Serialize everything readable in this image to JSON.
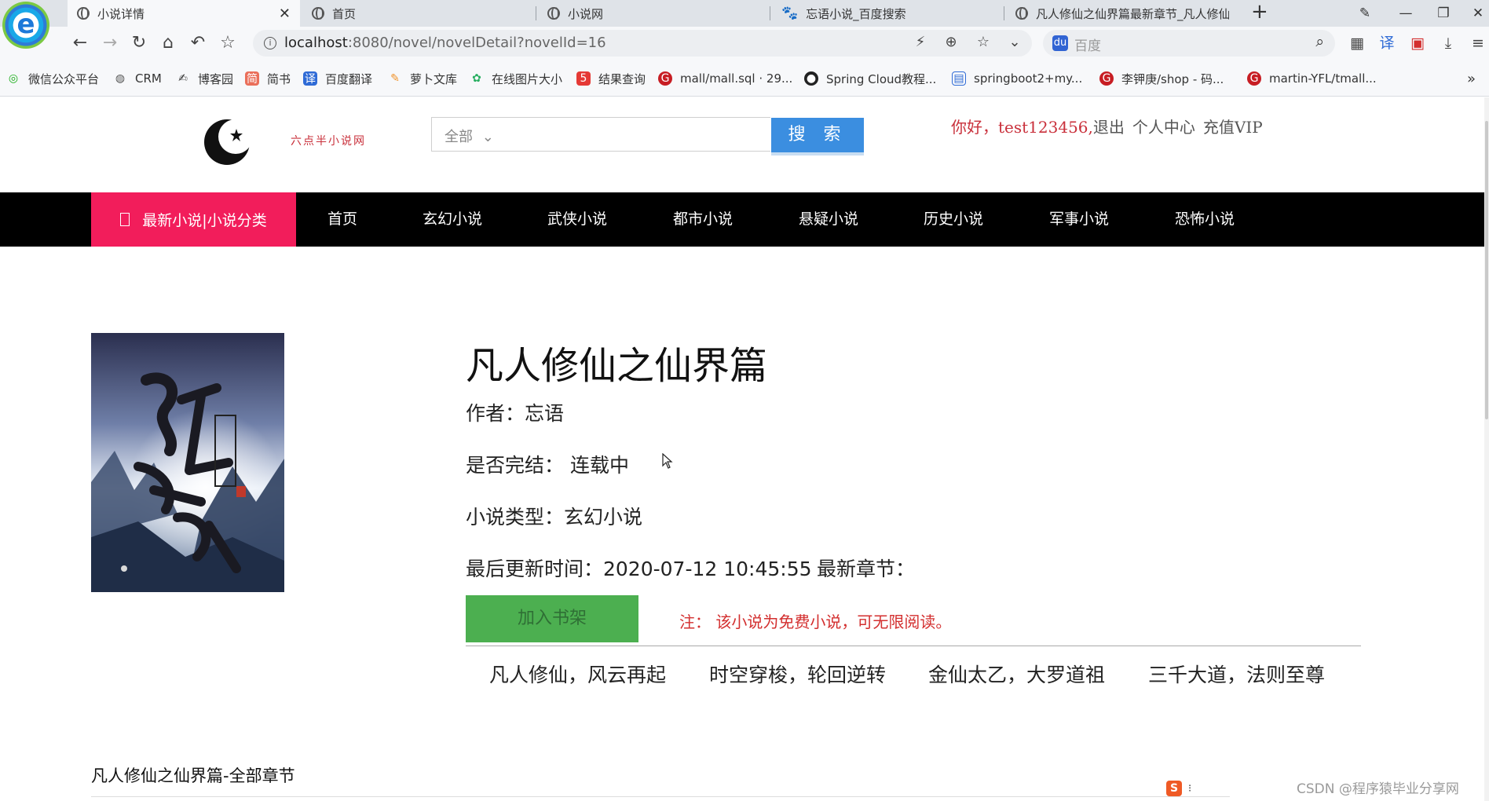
{
  "browser": {
    "tabs": [
      {
        "title": "小说详情",
        "active": true
      },
      {
        "title": "首页"
      },
      {
        "title": "小说网"
      },
      {
        "title": "忘语小说_百度搜索"
      },
      {
        "title": "凡人修仙之仙界篇最新章节_凡人修仙"
      }
    ],
    "address": {
      "host": "localhost",
      "rest": ":8080/novel/novelDetail?novelId=16"
    },
    "search_placeholder": "百度",
    "bookmarks": [
      {
        "label": "微信公众平台",
        "icon": "wechat-icon",
        "color": "#1aad19"
      },
      {
        "label": "CRM",
        "icon": "globe-icon",
        "color": "#555555"
      },
      {
        "label": "博客园",
        "icon": "cnblogs-icon",
        "color": "#333333"
      },
      {
        "label": "简书",
        "icon": "jianshu-icon",
        "color": "#ea6f5a"
      },
      {
        "label": "百度翻译",
        "icon": "translate-icon",
        "color": "#2f6bd6"
      },
      {
        "label": "萝卜文库",
        "icon": "carrot-icon",
        "color": "#f0932b"
      },
      {
        "label": "在线图片大小",
        "icon": "gear-icon",
        "color": "#27ae60"
      },
      {
        "label": "结果查询",
        "icon": "five-icon",
        "color": "#e53935"
      },
      {
        "label": "mall/mall.sql · 29...",
        "icon": "gitee-icon",
        "color": "#c71d23"
      },
      {
        "label": "Spring Cloud教程...",
        "icon": "github-icon",
        "color": "#222222"
      },
      {
        "label": "springboot2+my...",
        "icon": "blog-icon",
        "color": "#2f6bd6"
      },
      {
        "label": "李钾庚/shop - 码...",
        "icon": "gitee-icon",
        "color": "#c71d23"
      },
      {
        "label": "martin-YFL/tmall...",
        "icon": "gitee-icon",
        "color": "#c71d23"
      }
    ]
  },
  "site": {
    "name": "六点半小说网",
    "search": {
      "category": "全部",
      "button": "搜 索"
    },
    "user": {
      "greeting": "你好，test123456,",
      "logout": "退出",
      "center": "个人中心",
      "vip": "充值VIP"
    },
    "nav": {
      "category_label": "最新小说|小说分类",
      "items": [
        "首页",
        "玄幻小说",
        "武侠小说",
        "都市小说",
        "悬疑小说",
        "历史小说",
        "军事小说",
        "恐怖小说"
      ]
    }
  },
  "novel": {
    "title": "凡人修仙之仙界篇",
    "author": "作者：忘语",
    "status": "是否完结：  连载中",
    "type": "小说类型：玄幻小说",
    "updated": "最后更新时间：2020-07-12 10:45:55",
    "latest": "最新章节：",
    "add_shelf": "加入书架",
    "note": "注：  该小说为免费小说，可无限阅读。",
    "tags": [
      "凡人修仙，风云再起",
      "时空穿梭，轮回逆转",
      "金仙太乙，大罗道祖",
      "三千大道，法则至尊"
    ],
    "chapters_title": "凡人修仙之仙界篇-全部章节"
  },
  "watermark": "CSDN @程序猿毕业分享网"
}
